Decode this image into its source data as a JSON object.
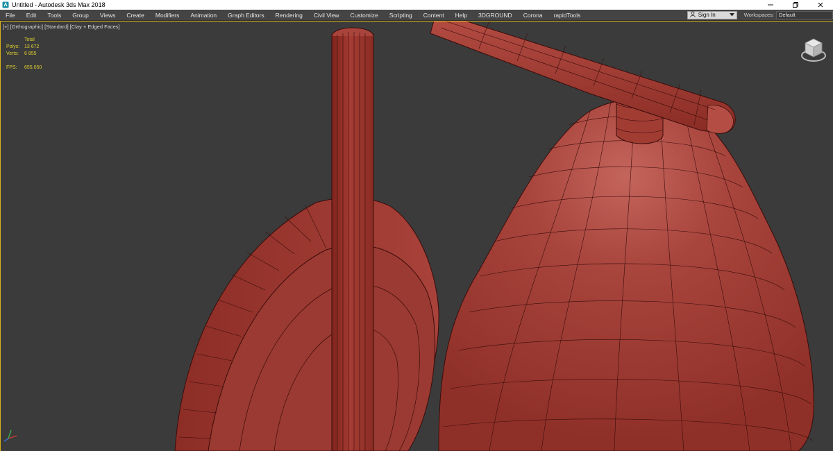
{
  "window": {
    "title": "Untitled - Autodesk 3ds Max 2018",
    "app_icon": "3dsmax-icon",
    "controls": [
      "minimize-icon",
      "restore-icon",
      "close-icon"
    ]
  },
  "menu": {
    "items": [
      "File",
      "Edit",
      "Tools",
      "Group",
      "Views",
      "Create",
      "Modifiers",
      "Animation",
      "Graph Editors",
      "Rendering",
      "Civil View",
      "Customize",
      "Scripting",
      "Content",
      "Help",
      "3DGROUND",
      "Corona",
      "rapidTools"
    ],
    "sign_in": "Sign In",
    "workspaces_label": "Workspaces:",
    "workspaces_value": "Default"
  },
  "viewport": {
    "labels": [
      "[+]",
      "[Orthographic]",
      "[Standard]",
      "[Clay + Edged Faces]"
    ],
    "stats": {
      "header": "Total",
      "polys_label": "Polys:",
      "polys_value": "13 672",
      "verts_label": "Verts:",
      "verts_value": "6 855",
      "fps_label": "FPS:",
      "fps_value": "655,050"
    }
  },
  "colors": {
    "viewport_bg": "#3b3b3b",
    "clay": "#a33a32",
    "wire": "#3a0c0a",
    "active_border": "#d8b21a",
    "stats_text": "#e0d030"
  }
}
